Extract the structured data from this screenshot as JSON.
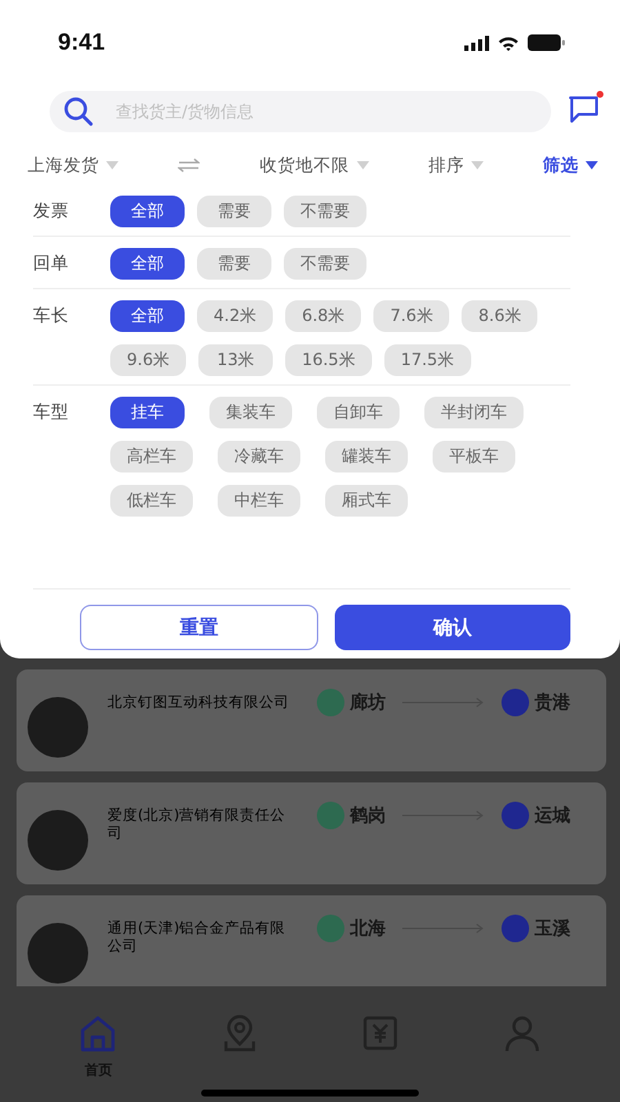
{
  "status_bar": {
    "time": "9:41"
  },
  "search": {
    "placeholder": "查找货主/货物信息",
    "has_unread": true
  },
  "filter_bar": [
    {
      "label": "上海发货",
      "kind": "dropdown",
      "selected": false
    },
    {
      "kind": "swap"
    },
    {
      "label": "收货地不限",
      "kind": "dropdown",
      "selected": false
    },
    {
      "label": "排序",
      "kind": "dropdown",
      "selected": false
    },
    {
      "label": "筛选",
      "kind": "dropdown",
      "selected": true
    }
  ],
  "filter_groups": [
    {
      "label": "发票",
      "options": [
        {
          "label": "全部",
          "selected": true
        },
        {
          "label": "需要",
          "selected": false
        },
        {
          "label": "不需要",
          "selected": false
        }
      ]
    },
    {
      "label": "回单",
      "options": [
        {
          "label": "全部",
          "selected": true
        },
        {
          "label": "需要",
          "selected": false
        },
        {
          "label": "不需要",
          "selected": false
        }
      ]
    },
    {
      "label": "车长",
      "options": [
        {
          "label": "全部",
          "selected": true
        },
        {
          "label": "4.2米",
          "selected": false
        },
        {
          "label": "6.8米",
          "selected": false
        },
        {
          "label": "7.6米",
          "selected": false
        },
        {
          "label": "8.6米",
          "selected": false
        },
        {
          "label": "9.6米",
          "selected": false
        },
        {
          "label": "13米",
          "selected": false
        },
        {
          "label": "16.5米",
          "selected": false
        },
        {
          "label": "17.5米",
          "selected": false
        }
      ]
    },
    {
      "label": "车型",
      "options": [
        {
          "label": "挂车",
          "selected": true
        },
        {
          "label": "集装车",
          "selected": false
        },
        {
          "label": "自卸车",
          "selected": false
        },
        {
          "label": "半封闭车",
          "selected": false
        },
        {
          "label": "高栏车",
          "selected": false
        },
        {
          "label": "冷藏车",
          "selected": false
        },
        {
          "label": "罐装车",
          "selected": false
        },
        {
          "label": "平板车",
          "selected": false
        },
        {
          "label": "低栏车",
          "selected": false
        },
        {
          "label": "中栏车",
          "selected": false
        },
        {
          "label": "厢式车",
          "selected": false
        }
      ]
    }
  ],
  "buttons": {
    "reset": "重置",
    "confirm": "确认"
  },
  "orders": [
    {
      "company": "北京钉图互动科技有限公司",
      "from": "廊坊",
      "to": "贵港"
    },
    {
      "company": "爱度(北京)营销有限责任公司",
      "from": "鹤岗",
      "to": "运城"
    },
    {
      "company": "通用(天津)铝合金产品有限公司",
      "from": "北海",
      "to": "玉溪"
    }
  ],
  "tab_bar": [
    {
      "kind": "home",
      "label": "首页",
      "selected": true
    },
    {
      "kind": "location",
      "selected": false
    },
    {
      "kind": "money",
      "selected": false
    },
    {
      "kind": "profile",
      "selected": false
    }
  ]
}
